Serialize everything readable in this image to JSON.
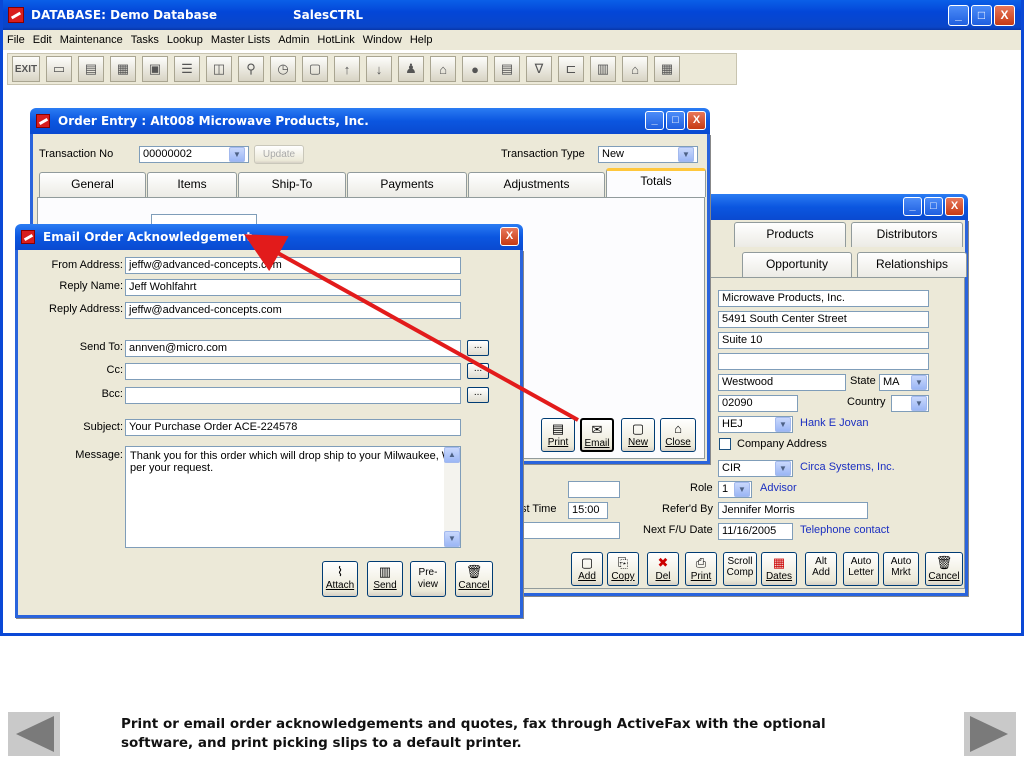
{
  "window": {
    "title_left": "DATABASE:  Demo Database",
    "title_right": "SalesCTRL",
    "minimize_label": "_",
    "maximize_label": "□",
    "close_label": "X"
  },
  "menu": [
    "File",
    "Edit",
    "Maintenance",
    "Tasks",
    "Lookup",
    "Master Lists",
    "Admin",
    "HotLink",
    "Window",
    "Help"
  ],
  "toolbar": {
    "exit_label": "EXIT",
    "icons": [
      "open-folder-icon",
      "folder-icon",
      "screen-icon",
      "card-icon",
      "notepad-icon",
      "window-icon",
      "binoculars-icon",
      "clock-icon",
      "frame-icon",
      "up-arrow-icon",
      "down-arrow-icon",
      "user-icon",
      "inbox-icon",
      "circle-icon",
      "document-icon",
      "filter-icon",
      "tag-icon",
      "book-icon",
      "building-icon",
      "report-icon"
    ],
    "glyphs": [
      "▭",
      "▤",
      "▦",
      "▣",
      "☰",
      "◫",
      "⚲",
      "◷",
      "▢",
      "↑",
      "↓",
      "♟",
      "⌂",
      "●",
      "▤",
      "∇",
      "⊏",
      "▥",
      "⌂",
      "▦"
    ]
  },
  "order_entry": {
    "title": "Order Entry : Alt008    Microwave Products, Inc.",
    "transaction_no_label": "Transaction No",
    "transaction_no": "00000002",
    "update_label": "Update",
    "transaction_type_label": "Transaction Type",
    "transaction_type": "New",
    "tabs": [
      "General",
      "Items",
      "Ship-To",
      "Payments",
      "Adjustments",
      "Totals"
    ],
    "buttons": {
      "print": "Print",
      "email": "Email",
      "new": "New",
      "close": "Close"
    }
  },
  "customer": {
    "tabs_row1": [
      "Products",
      "Distributors"
    ],
    "tabs_row2": [
      "Opportunity",
      "Relationships"
    ],
    "company": "Microwave Products, Inc.",
    "address1": "5491 South Center Street",
    "address2": "Suite 10",
    "address3": "",
    "city": "Westwood",
    "state_label": "State",
    "state": "MA",
    "zip": "02090",
    "country_label": "Country",
    "country": "",
    "rep_code": "HEJ",
    "rep_name": "Hank E Jovan",
    "company_address_label": "Company Address",
    "lead_code": "CIR",
    "lead_name": "Circa Systems, Inc.",
    "role_label": "Role",
    "role": "1",
    "role_name": "Advisor",
    "time_label": "st Time",
    "time": "15:00",
    "referd_by_label": "Refer'd By",
    "referd_by": "Jennifer Morris",
    "next_fu_label": "Next F/U Date",
    "next_fu": "11/16/2005",
    "next_fu_type": "Telephone contact",
    "buttons": [
      "Add",
      "Copy",
      "Del",
      "Print",
      "Scroll Comp",
      "Dates",
      "Alt Add",
      "Auto Letter",
      "Auto Mrkt",
      "Cancel"
    ]
  },
  "email": {
    "title": "Email Order Acknowledgement",
    "from_label": "From Address:",
    "from": "jeffw@advanced-concepts.com",
    "reply_name_label": "Reply Name:",
    "reply_name": "Jeff Wohlfahrt",
    "reply_address_label": "Reply Address:",
    "reply_address": "jeffw@advanced-concepts.com",
    "send_to_label": "Send To:",
    "send_to": "annven@micro.com",
    "cc_label": "Cc:",
    "cc": "",
    "bcc_label": "Bcc:",
    "bcc": "",
    "ellipsis": "...",
    "subject_label": "Subject:",
    "subject": "Your Purchase Order ACE-224578",
    "message_label": "Message:",
    "message": "Thank you for this order which will drop ship to your Milwaukee, WI per your request.",
    "buttons": {
      "attach": "Attach",
      "send": "Send",
      "preview": "Pre-view",
      "cancel": "Cancel"
    }
  },
  "caption": "Print or email order acknowledgements and quotes, fax through ActiveFax with the optional software, and print picking slips to a default printer.",
  "nav": {
    "prev": "previous-slide",
    "next": "next-slide"
  }
}
